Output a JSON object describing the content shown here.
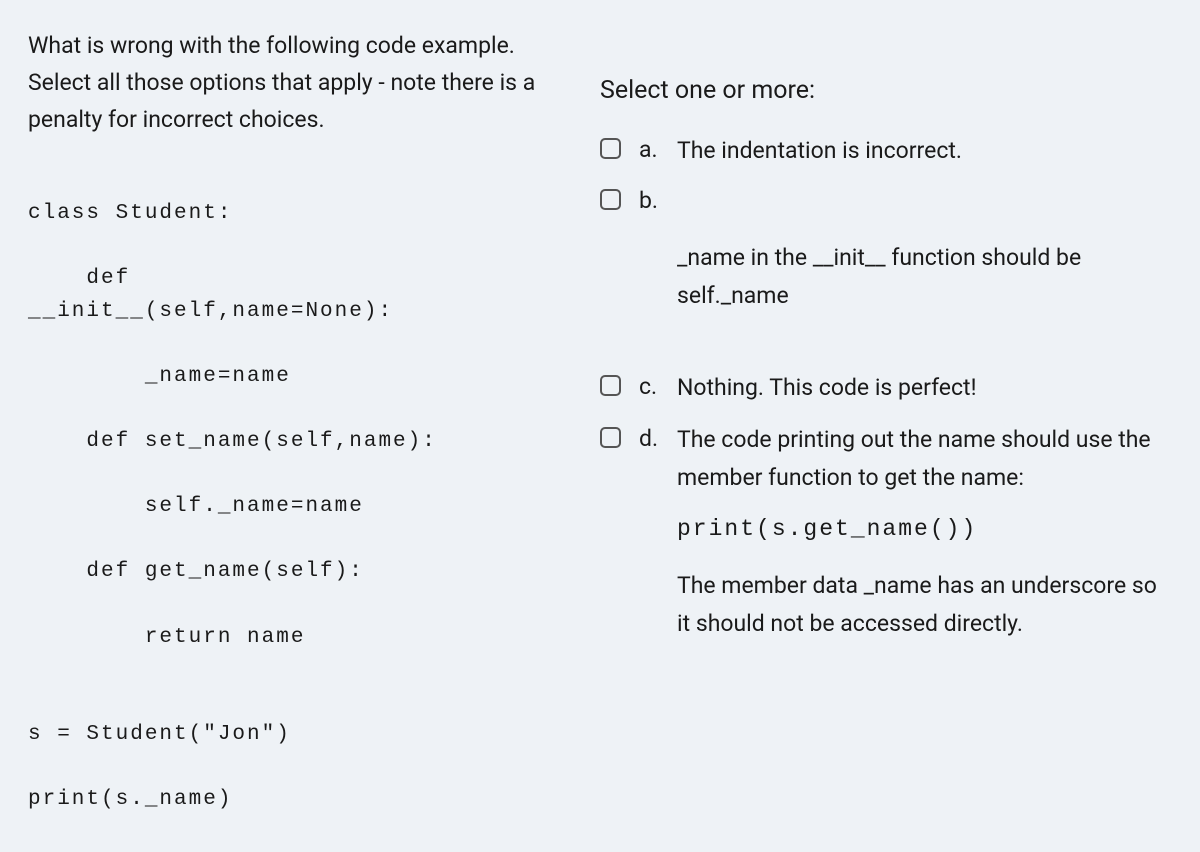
{
  "question": {
    "prompt": "What is wrong with the following code example. Select all those options that apply - note there is a penalty for incorrect choices.",
    "code": "class Student:\n\n    def\n__init__(self,name=None):\n\n        _name=name\n\n    def set_name(self,name):\n\n        self._name=name\n\n    def get_name(self):\n\n        return name\n\n\ns = Student(\"Jon\")\n\nprint(s._name)"
  },
  "answers": {
    "instruction": "Select one or more:",
    "a": {
      "letter": "a.",
      "text": "The indentation is incorrect."
    },
    "b": {
      "letter": "b.",
      "text": "_name in the __init__ function should be self._name"
    },
    "c": {
      "letter": "c.",
      "text": "Nothing. This code is perfect!"
    },
    "d": {
      "letter": "d.",
      "intro": "The code printing out the name should use the member function to get the name:",
      "code": "print(s.get_name())",
      "trail": "The member data _name has an underscore so it should not be accessed directly."
    }
  }
}
